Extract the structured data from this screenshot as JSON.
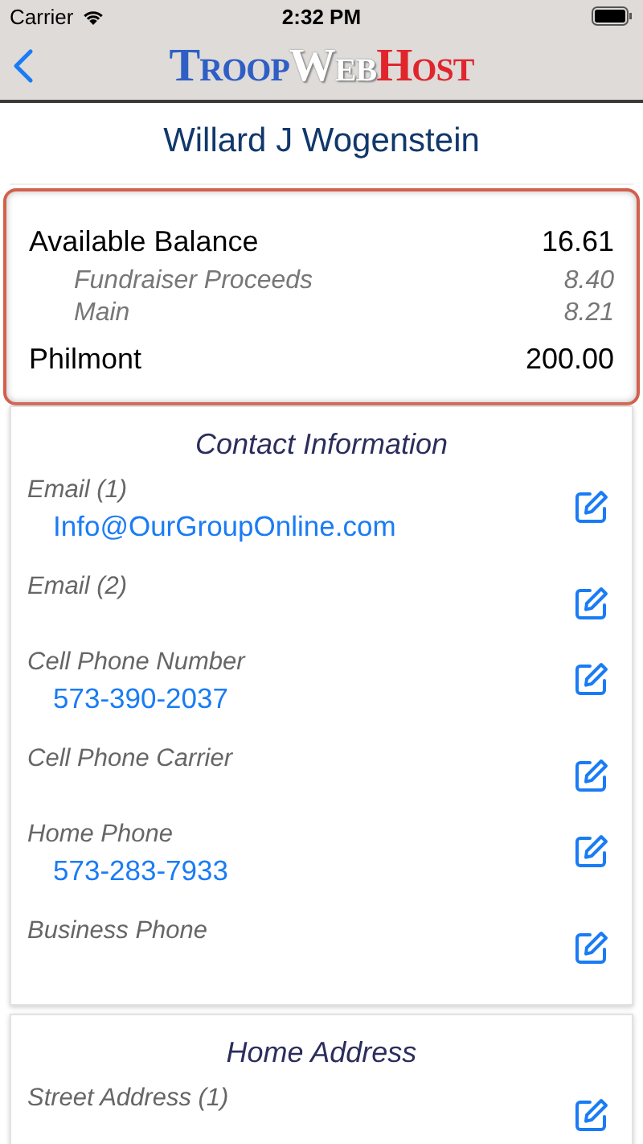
{
  "status_bar": {
    "carrier": "Carrier",
    "time": "2:32 PM"
  },
  "nav": {
    "logo": [
      {
        "text": "Troop",
        "color": "#2f5fc4"
      },
      {
        "text": "Web",
        "color": "#ffffff"
      },
      {
        "text": "Host",
        "color": "#e0262c"
      }
    ]
  },
  "member_name": "Willard J Wogenstein",
  "balances": [
    {
      "label": "Available Balance",
      "amount": "16.61",
      "kind": "total"
    },
    {
      "label": "Fundraiser Proceeds",
      "amount": "8.40",
      "kind": "sub"
    },
    {
      "label": "Main",
      "amount": "8.21",
      "kind": "sub"
    },
    {
      "label": "Philmont",
      "amount": "200.00",
      "kind": "total"
    }
  ],
  "sections": [
    {
      "title": "Contact Information",
      "fields": [
        {
          "label": "Email (1)",
          "value": "Info@OurGroupOnline.com"
        },
        {
          "label": "Email (2)"
        },
        {
          "label": "Cell Phone Number",
          "value": "573-390-2037"
        },
        {
          "label": "Cell Phone Carrier"
        },
        {
          "label": "Home Phone",
          "value": "573-283-7933"
        },
        {
          "label": "Business Phone"
        }
      ]
    },
    {
      "title": "Home Address",
      "fields": [
        {
          "label": "Street Address (1)"
        }
      ]
    }
  ]
}
